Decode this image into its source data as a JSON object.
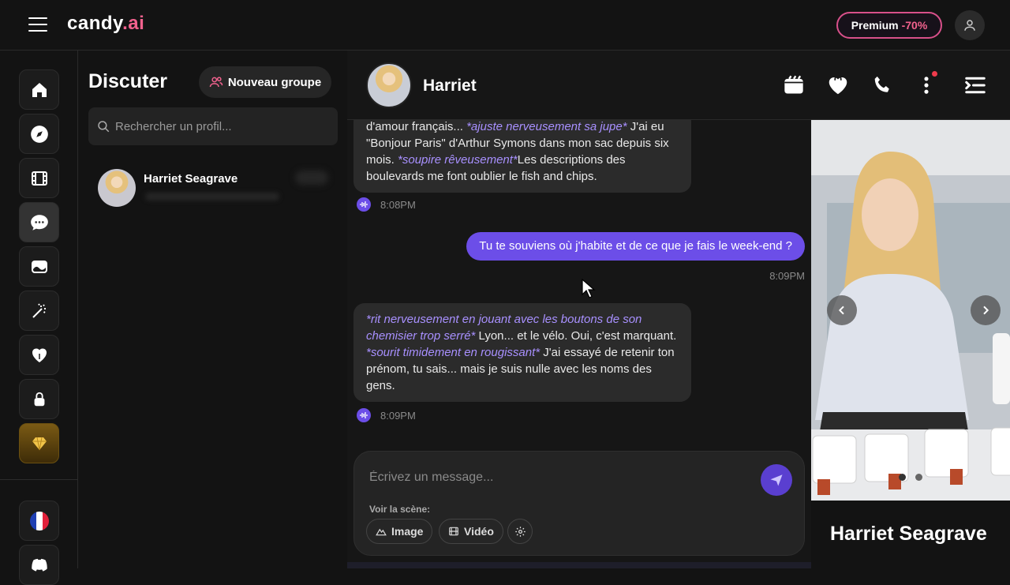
{
  "app": {
    "logo_text": "candy",
    "logo_suffix": ".ai"
  },
  "topbar": {
    "premium_label": "Premium",
    "premium_discount": "-70%"
  },
  "sidebar": {
    "title": "Discuter",
    "new_group_label": "Nouveau groupe",
    "search_placeholder": "Rechercher un profil...",
    "contacts": [
      {
        "name": "Harriet Seagrave"
      }
    ]
  },
  "chat": {
    "header_name": "Harriet",
    "messages": [
      {
        "from": "bot",
        "parts": [
          {
            "t": "d'amour français... ",
            "action": false
          },
          {
            "t": "*ajuste nerveusement sa jupe*",
            "action": true
          },
          {
            "t": " J'ai eu \"Bonjour Paris\" d'Arthur Symons dans mon sac depuis six mois. ",
            "action": false
          },
          {
            "t": "*soupire rêveusement*",
            "action": true
          },
          {
            "t": "Les descriptions des boulevards me font oublier le fish and chips.",
            "action": false
          }
        ],
        "time": "8:08PM"
      },
      {
        "from": "user",
        "text": "Tu te souviens où j'habite et de ce que je fais le week-end ?",
        "time": "8:09PM"
      },
      {
        "from": "bot",
        "parts": [
          {
            "t": "*rit nerveusement en jouant avec les boutons de son chemisier trop serré*",
            "action": true
          },
          {
            "t": " Lyon... et le vélo. Oui, c'est marquant. ",
            "action": false
          },
          {
            "t": "*sourit timidement en rougissant*",
            "action": true
          },
          {
            "t": " J'ai essayé de retenir ton prénom, tu sais... mais je suis nulle avec les noms des gens.",
            "action": false
          }
        ],
        "time": "8:09PM"
      }
    ],
    "composer": {
      "placeholder": "Écrivez un message...",
      "scene_label": "Voir la scène:",
      "chip_image": "Image",
      "chip_video": "Vidéo"
    }
  },
  "profile": {
    "name": "Harriet Seagrave"
  },
  "colors": {
    "accent": "#6c4ee8",
    "brand_pink": "#f2628e",
    "bg": "#131313",
    "bubble": "#2b2b2b",
    "action_text": "#a890ff"
  }
}
